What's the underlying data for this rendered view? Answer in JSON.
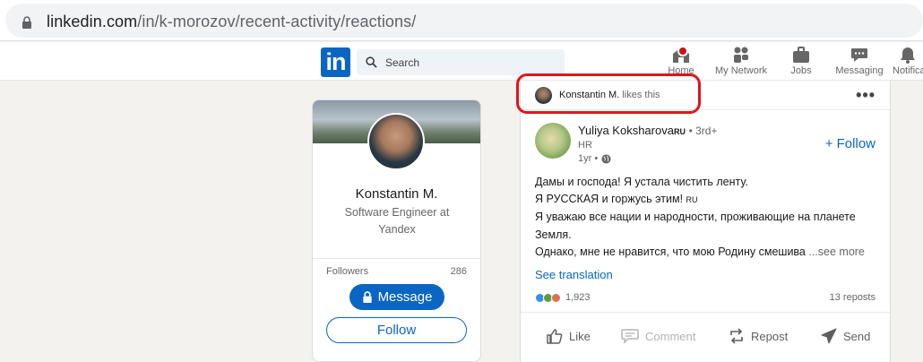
{
  "browser": {
    "url_host": "linkedin.com",
    "url_path": "/in/k-morozov/recent-activity/reactions/"
  },
  "nav": {
    "search_placeholder": "Search",
    "items": [
      {
        "label": "Home",
        "icon": "home-icon"
      },
      {
        "label": "My Network",
        "icon": "network-icon"
      },
      {
        "label": "Jobs",
        "icon": "briefcase-icon"
      },
      {
        "label": "Messaging",
        "icon": "messaging-icon"
      },
      {
        "label": "Notifications",
        "icon": "bell-icon"
      }
    ]
  },
  "profile": {
    "name": "Konstantin M.",
    "headline": "Software Engineer at Yandex",
    "followers_label": "Followers",
    "followers_count": "286",
    "message_label": "Message",
    "follow_label": "Follow"
  },
  "post": {
    "activity_actor": "Konstantin M.",
    "activity_verb": "likes this",
    "author_name": "Yuliya Koksharova",
    "author_flag": "RU",
    "author_degree": "• 3rd+",
    "author_headline": "HR",
    "author_time": "1yr •",
    "follow_label": "+ Follow",
    "lines": [
      "Дамы и господа! Я устала чистить ленту.",
      "Я РУССКАЯ и горжусь этим!",
      "Я уважаю все нации и народности, проживающие на планете",
      "Земля.",
      "Однако, мне не нравится, что мою Родину смешива"
    ],
    "line2_flag": "RU",
    "see_more": "...see more",
    "see_translation": "See translation",
    "reactions_count": "1,923",
    "reposts": "13 reposts",
    "actions": {
      "like": "Like",
      "comment": "Comment",
      "repost": "Repost",
      "send": "Send"
    }
  },
  "colors": {
    "brand": "#0a66c2",
    "highlight": "#e0141c",
    "badge": "#cc1016"
  }
}
